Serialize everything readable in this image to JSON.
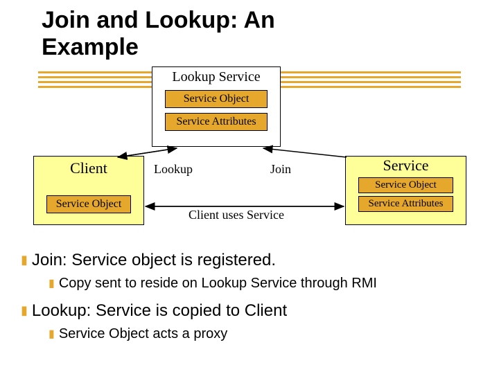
{
  "title_line1": "Join and Lookup: An",
  "title_line2": "Example",
  "lookup_service": {
    "title": "Lookup Service",
    "obj": "Service Object",
    "attrs": "Service Attributes"
  },
  "client": {
    "title": "Client",
    "obj": "Service Object"
  },
  "service": {
    "title": "Service",
    "obj": "Service Object",
    "attrs": "Service Attributes"
  },
  "arrows": {
    "lookup": "Lookup",
    "join": "Join",
    "uses": "Client uses Service"
  },
  "bullets": {
    "join": "Join: Service object is registered.",
    "join_sub": "Copy sent to reside on Lookup Service through RMI",
    "lookup": "Lookup: Service is copied to Client",
    "lookup_sub": "Service Object acts a proxy"
  }
}
